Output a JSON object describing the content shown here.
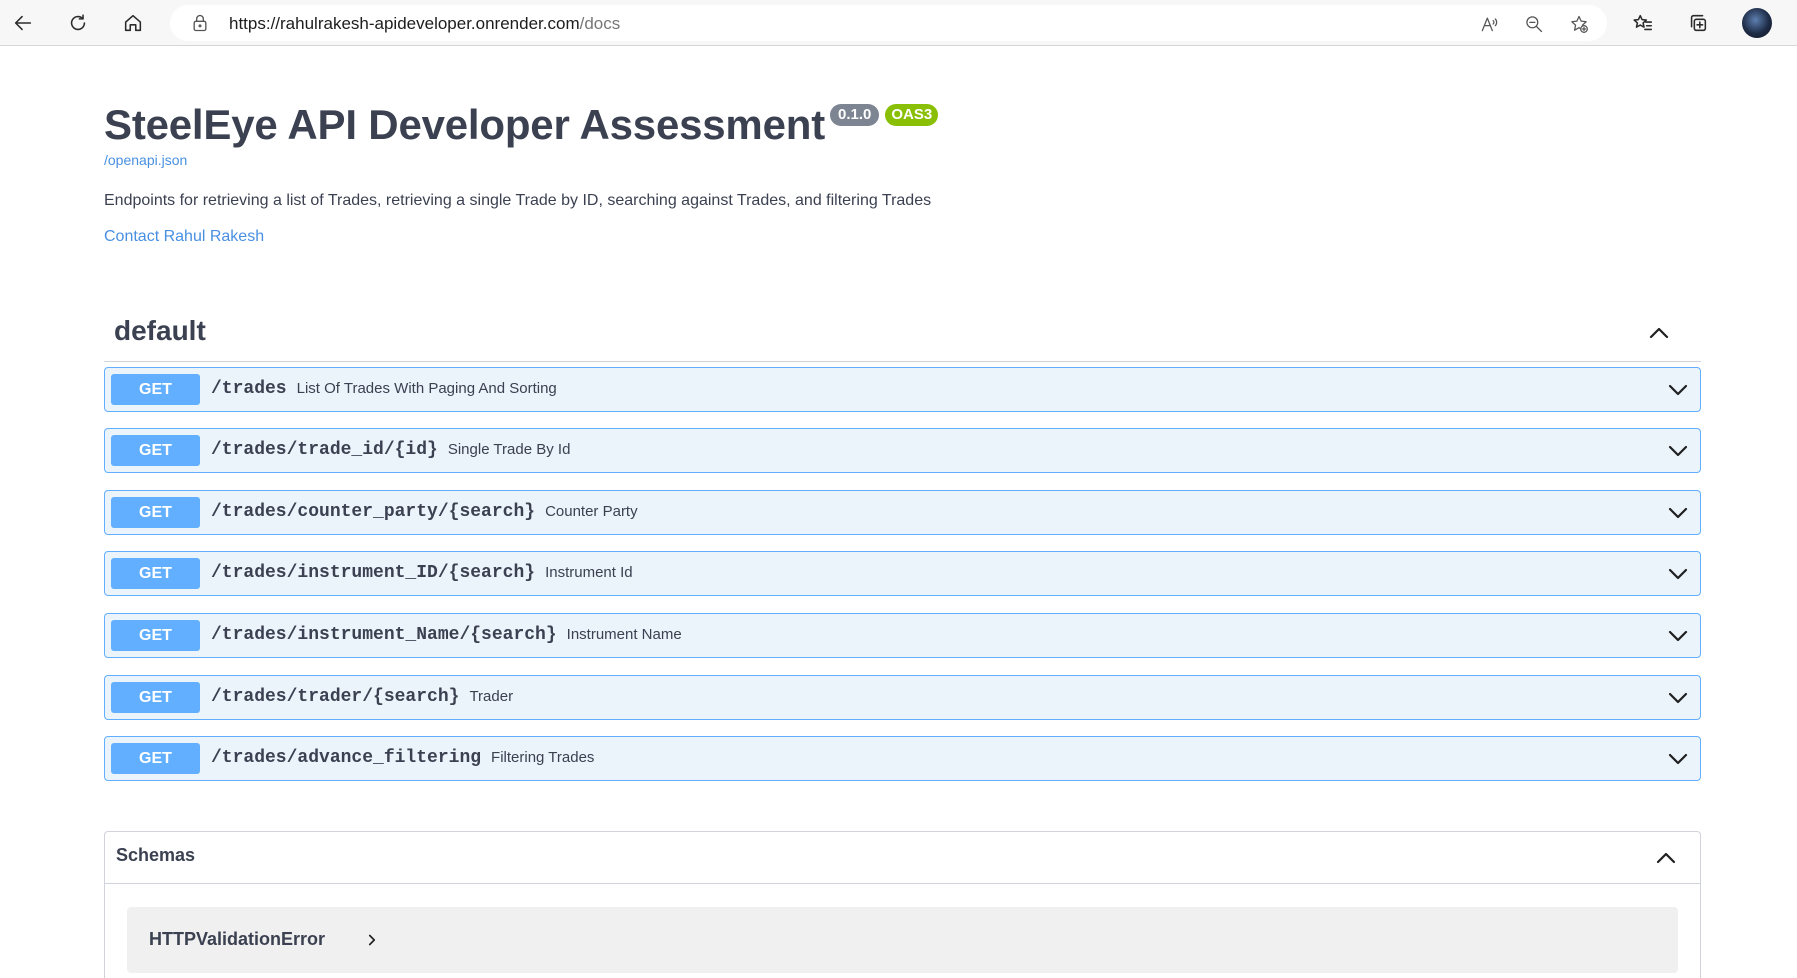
{
  "browser": {
    "url_host": "https://rahulrakesh-apideveloper.onrender.com",
    "url_path": "/docs",
    "read_aloud_label": "A̅",
    "icons": [
      "back-icon",
      "refresh-icon",
      "home-icon",
      "lock-icon",
      "read-aloud-icon",
      "zoom-out-icon",
      "add-favorite-icon",
      "favorites-icon",
      "collections-icon",
      "profile-avatar"
    ]
  },
  "info": {
    "title": "SteelEye API Developer Assessment",
    "version": "0.1.0",
    "oas": "OAS3",
    "openapi_link": "/openapi.json",
    "description": "Endpoints for retrieving a list of Trades, retrieving a single Trade by ID, searching against Trades, and filtering Trades",
    "contact": "Contact Rahul Rakesh"
  },
  "tag": {
    "name": "default"
  },
  "operations": [
    {
      "method": "GET",
      "path": "/trades",
      "summary": "List Of Trades With Paging And Sorting"
    },
    {
      "method": "GET",
      "path": "/trades/trade_id/{id}",
      "summary": "Single Trade By Id"
    },
    {
      "method": "GET",
      "path": "/trades/counter_party/{search}",
      "summary": "Counter Party"
    },
    {
      "method": "GET",
      "path": "/trades/instrument_ID/{search}",
      "summary": "Instrument Id"
    },
    {
      "method": "GET",
      "path": "/trades/instrument_Name/{search}",
      "summary": "Instrument Name"
    },
    {
      "method": "GET",
      "path": "/trades/trader/{search}",
      "summary": "Trader"
    },
    {
      "method": "GET",
      "path": "/trades/advance_filtering",
      "summary": "Filtering Trades"
    }
  ],
  "schemas": {
    "title": "Schemas",
    "models": [
      "HTTPValidationError"
    ]
  },
  "colors": {
    "get_accent": "#61affe",
    "get_bg": "#ebf3fb",
    "version_badge": "#7d8492",
    "oas_badge": "#89bf04",
    "link": "#4990e2",
    "text": "#3b4151"
  }
}
